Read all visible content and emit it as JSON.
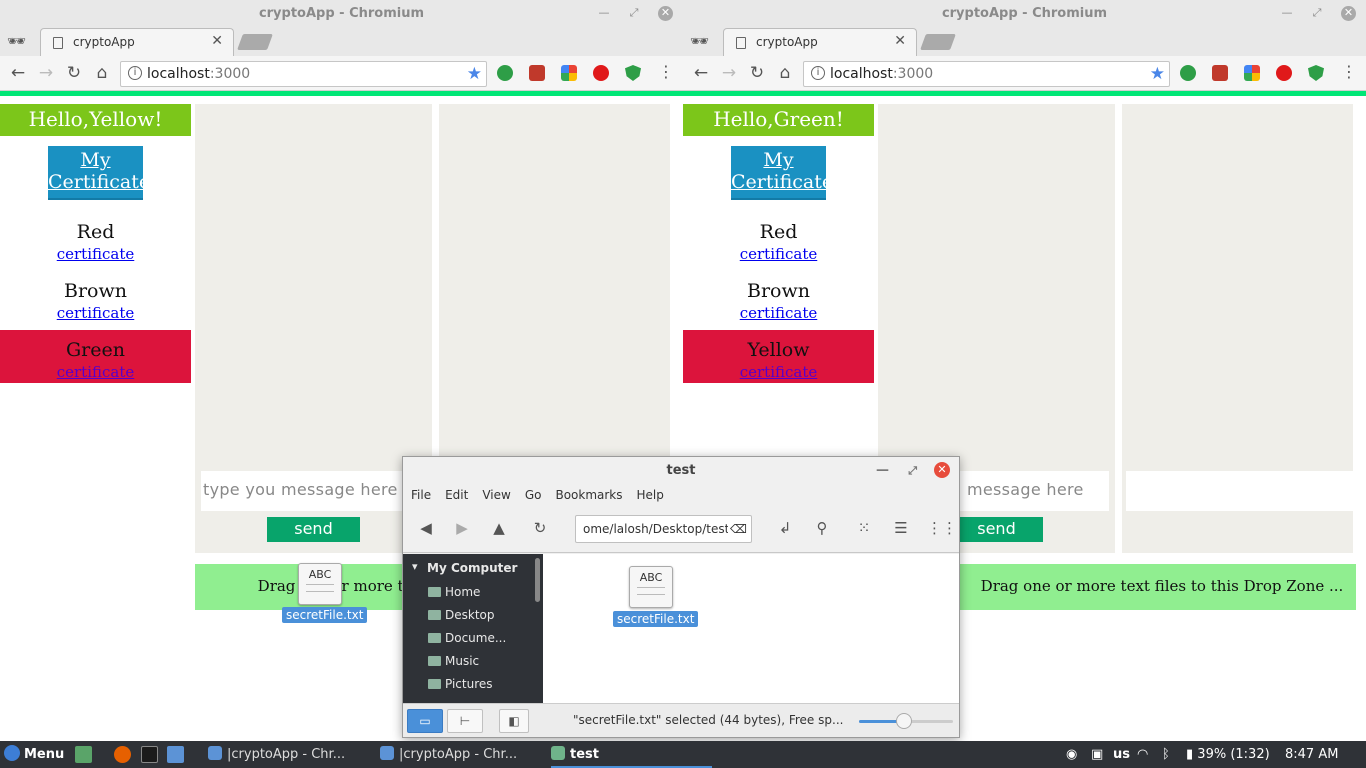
{
  "browsers": [
    {
      "window_title": "cryptoApp - Chromium",
      "tab_title": "cryptoApp",
      "url_host": "localhost",
      "url_port": ":3000",
      "greeting": "Hello,Yellow!",
      "my_certificate": "My Certificate",
      "users": [
        {
          "name": "Red",
          "link": "certificate"
        },
        {
          "name": "Brown",
          "link": "certificate"
        },
        {
          "name": "Green",
          "link": "certificate"
        }
      ],
      "message_placeholder": "type you message here",
      "send_label": "send",
      "dropzone_text": "Drag one or more text files to this Drop Zone ..."
    },
    {
      "window_title": "cryptoApp - Chromium",
      "tab_title": "cryptoApp",
      "url_host": "localhost",
      "url_port": ":3000",
      "greeting": "Hello,Green!",
      "my_certificate": "My Certificate",
      "users": [
        {
          "name": "Red",
          "link": "certificate"
        },
        {
          "name": "Brown",
          "link": "certificate"
        },
        {
          "name": "Yellow",
          "link": "certificate"
        }
      ],
      "message_placeholder": "message here",
      "send_label": "send",
      "dropzone_text": "Drag one or more text files to this Drop Zone ..."
    }
  ],
  "dragged_file": {
    "icon_text": "ABC",
    "name": "secretFile.txt"
  },
  "file_manager": {
    "title": "test",
    "menu": [
      "File",
      "Edit",
      "View",
      "Go",
      "Bookmarks",
      "Help"
    ],
    "path": "ome/lalosh/Desktop/test",
    "sidebar_header": "My Computer",
    "places": [
      "Home",
      "Desktop",
      "Docume...",
      "Music",
      "Pictures"
    ],
    "file": {
      "icon_text": "ABC",
      "name": "secretFile.txt"
    },
    "status": "\"secretFile.txt\" selected (44 bytes), Free sp...",
    "zoom_level": 0.48
  },
  "taskbar": {
    "menu_label": "Menu",
    "tasks": [
      "|cryptoApp - Chr...",
      "|cryptoApp - Chr...",
      "test"
    ],
    "keyboard": "us",
    "battery": "39% (1:32)",
    "clock": "8:47 AM"
  }
}
